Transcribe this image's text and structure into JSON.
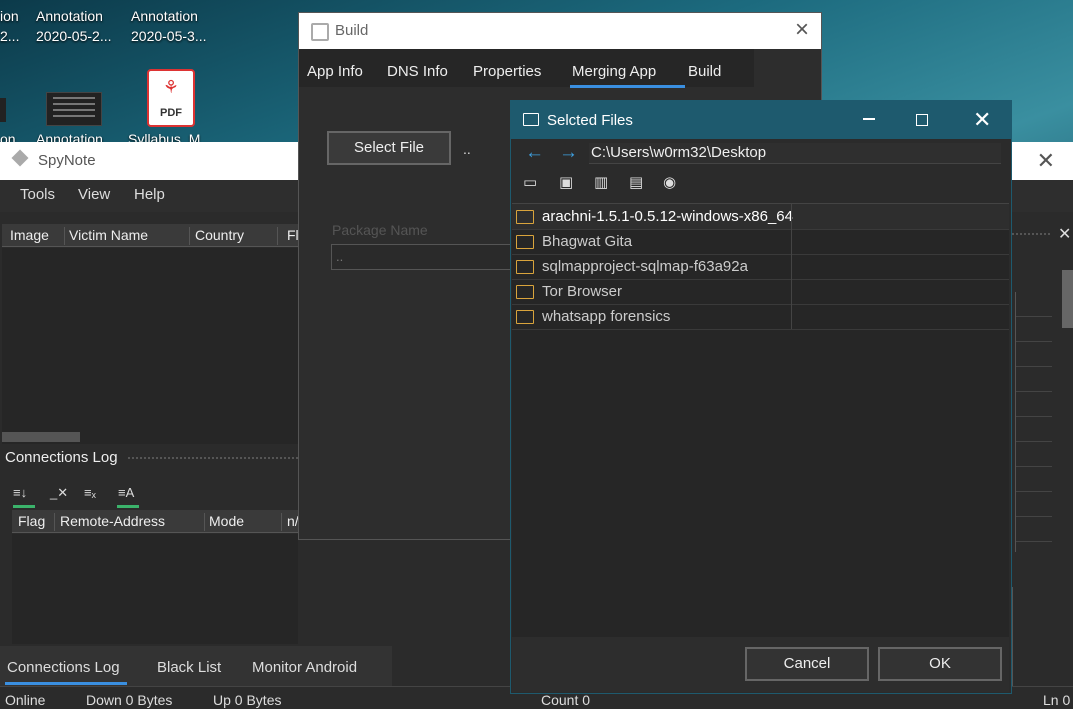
{
  "desktop": {
    "icons": [
      {
        "line1": "Annotation",
        "line2": "2020-05-2..."
      },
      {
        "line1": "Annotation",
        "line2": "2020-05-3..."
      }
    ],
    "partial_left_line1": "ion",
    "partial_left_line2": "2...",
    "row2_labels": [
      "on",
      "Annotation",
      "Syllabus_M..."
    ],
    "pdf_label": "PDF"
  },
  "spynote": {
    "title": "SpyNote",
    "menu": [
      "Tools",
      "View",
      "Help"
    ],
    "victims_columns": [
      "Image",
      "Victim Name",
      "Country",
      "Fl"
    ],
    "connections_title": "Connections Log",
    "log_columns": [
      "Flag",
      "Remote-Address",
      "Mode",
      "n/"
    ],
    "bottom_tabs": [
      "Connections Log",
      "Black List",
      "Monitor Android"
    ],
    "status": {
      "online": "Online",
      "down": "Down 0 Bytes",
      "up": "Up 0 Bytes",
      "count": "Count 0",
      "ln": "Ln 0"
    }
  },
  "build": {
    "title": "Build",
    "tabs": [
      "App Info",
      "DNS Info",
      "Properties",
      "Merging App",
      "Build"
    ],
    "active_tab": "Merging App",
    "select_file_label": "Select File",
    "select_file_value": "..",
    "package_label": "Package Name",
    "package_value": ".."
  },
  "dialog": {
    "title": "Selcted Files",
    "path": "C:\\Users\\w0rm32\\Desktop",
    "files": [
      "arachni-1.5.1-0.5.12-windows-x86_64",
      "Bhagwat Gita",
      "sqlmapproject-sqlmap-f63a92a",
      "Tor Browser",
      "whatsapp forensics"
    ],
    "cancel_label": "Cancel",
    "ok_label": "OK"
  }
}
